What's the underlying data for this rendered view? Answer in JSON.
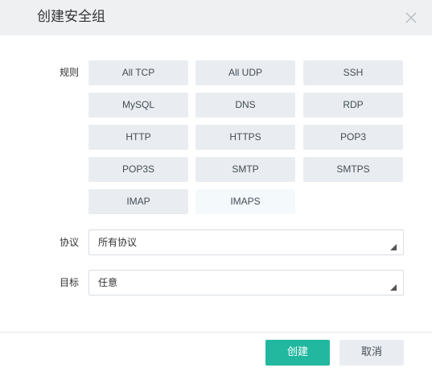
{
  "dialog": {
    "title": "创建安全组"
  },
  "rules": {
    "label": "规则",
    "items": [
      {
        "label": "All TCP"
      },
      {
        "label": "All UDP"
      },
      {
        "label": "SSH"
      },
      {
        "label": "MySQL"
      },
      {
        "label": "DNS"
      },
      {
        "label": "RDP"
      },
      {
        "label": "HTTP"
      },
      {
        "label": "HTTPS"
      },
      {
        "label": "POP3"
      },
      {
        "label": "POP3S"
      },
      {
        "label": "SMTP"
      },
      {
        "label": "SMTPS"
      },
      {
        "label": "IMAP"
      },
      {
        "label": "IMAPS"
      }
    ],
    "highlighted_item": "IMAPS"
  },
  "protocol": {
    "label": "协议",
    "value": "所有协议"
  },
  "target": {
    "label": "目标",
    "value": "任意"
  },
  "footer": {
    "create_label": "创建",
    "cancel_label": "取消"
  },
  "colors": {
    "primary": "#22b8a0",
    "rule_background": "#e9edf1",
    "rule_highlight_background": "#f4f9fc",
    "header_background": "#eef0f2"
  },
  "icons": {
    "close": "close-icon",
    "dropdown": "dropdown-arrow-icon"
  }
}
